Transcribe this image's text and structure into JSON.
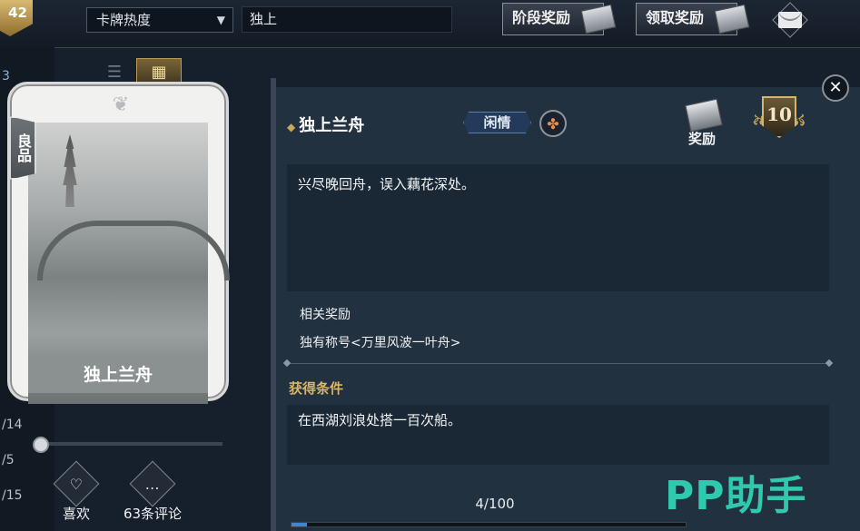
{
  "topbar": {
    "level_badge": "42",
    "sort_select": "卡牌热度",
    "search_value": "独上",
    "stage_reward_label": "阶段奖励",
    "claim_reward_label": "领取奖励"
  },
  "left_numbers": [
    "3",
    "/14",
    "/5",
    "/15"
  ],
  "card": {
    "quality": "良品",
    "name": "独上兰舟"
  },
  "actions": {
    "like_label": "喜欢",
    "comments_label": "63条评论"
  },
  "detail": {
    "title": "独上兰舟",
    "tag": "闲情",
    "reward_label": "奖励",
    "level": "10",
    "description": "兴尽晚回舟，误入藕花深处。",
    "related_rewards_title": "相关奖励",
    "related_reward_item": "独有称号<万里风波一叶舟>",
    "condition_title": "获得条件",
    "condition_text": "在西湖刘浪处搭一百次船。",
    "progress_text": "4/100",
    "progress_fraction": 0.04
  },
  "watermark": "PP助手",
  "colors": {
    "accent_gold": "#d9b46a",
    "progress_blue": "#3b86d6",
    "watermark_teal": "#2fc9b0"
  }
}
